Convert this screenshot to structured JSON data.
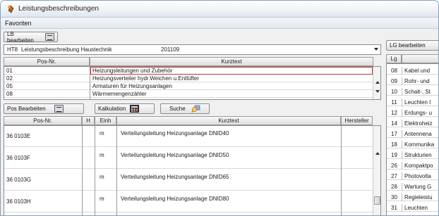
{
  "window": {
    "title": "Leistungsbeschreibungen"
  },
  "menu": {
    "favoriten": "Favoriten"
  },
  "left": {
    "lb_edit_label": "LB bearbeiten",
    "combo": {
      "code": "HT8",
      "name": "Leistungsbeschreibung Haustechnik",
      "version": "201109"
    },
    "top_headers": {
      "pos_nr": "Pos-Nr.",
      "kurztext": "Kurztext"
    },
    "top_rows": [
      {
        "pos": "01",
        "text": "Heizungsleitungen und Zubehör"
      },
      {
        "pos": "02",
        "text": "Heizungsverteiler hydr.Weichen u.Entlüfter"
      },
      {
        "pos": "05",
        "text": "Armaturen für Heizungsanlagen"
      },
      {
        "pos": "08",
        "text": "Wärmemengenzähler"
      }
    ],
    "toolbar": {
      "pos_bearbeiten": "Pos Bearbeiten",
      "kalkulation": "Kalkulation",
      "suche": "Suche"
    },
    "bottom_headers": {
      "pos_nr": "Pos-Nr.",
      "h": "H",
      "einh": "Einh",
      "kurztext": "Kurztext",
      "hersteller": "Hersteller"
    },
    "bottom_rows": [
      {
        "pos": "36 0103E",
        "einh": "m",
        "text": "Verteilungsleitung Heizungsanlage DNID40"
      },
      {
        "pos": "36 0103F",
        "einh": "m",
        "text": "Verteilungsleitung Heizungsanlage DNID50"
      },
      {
        "pos": "36 0103G",
        "einh": "m",
        "text": "Verteilungsleitung Heizungsanlage DNID65"
      },
      {
        "pos": "36 0103H",
        "einh": "m",
        "text": "Verteilungsleitung Heizungsanlage DNID80"
      }
    ]
  },
  "right": {
    "lg_edit_label": "LG bearbeiten",
    "header": {
      "lg": "Lg"
    },
    "rows": [
      {
        "num": "08",
        "text": "Kabel und"
      },
      {
        "num": "09",
        "text": "Rohr- und"
      },
      {
        "num": "10",
        "text": "Schalt-, St"
      },
      {
        "num": "11",
        "text": "Leuchten I"
      },
      {
        "num": "12",
        "text": "Erdungs- u"
      },
      {
        "num": "14",
        "text": "Elektroheiz"
      },
      {
        "num": "17",
        "text": "Antennena"
      },
      {
        "num": "18",
        "text": "Kommunika"
      },
      {
        "num": "19",
        "text": "Strukturien"
      },
      {
        "num": "26",
        "text": "Kompaktpo"
      },
      {
        "num": "27",
        "text": "Photovolta"
      },
      {
        "num": "28",
        "text": "Wartung G"
      },
      {
        "num": "30",
        "text": "Regieleistu"
      },
      {
        "num": "31",
        "text": "Leuchten"
      }
    ]
  },
  "colors": {
    "accent_red": "#c0392b",
    "window_bg": "#f0f0f0"
  },
  "icons": [
    "app-icon",
    "table-icon",
    "calculator-icon",
    "search-icon",
    "dropdown-arrow-icon"
  ]
}
